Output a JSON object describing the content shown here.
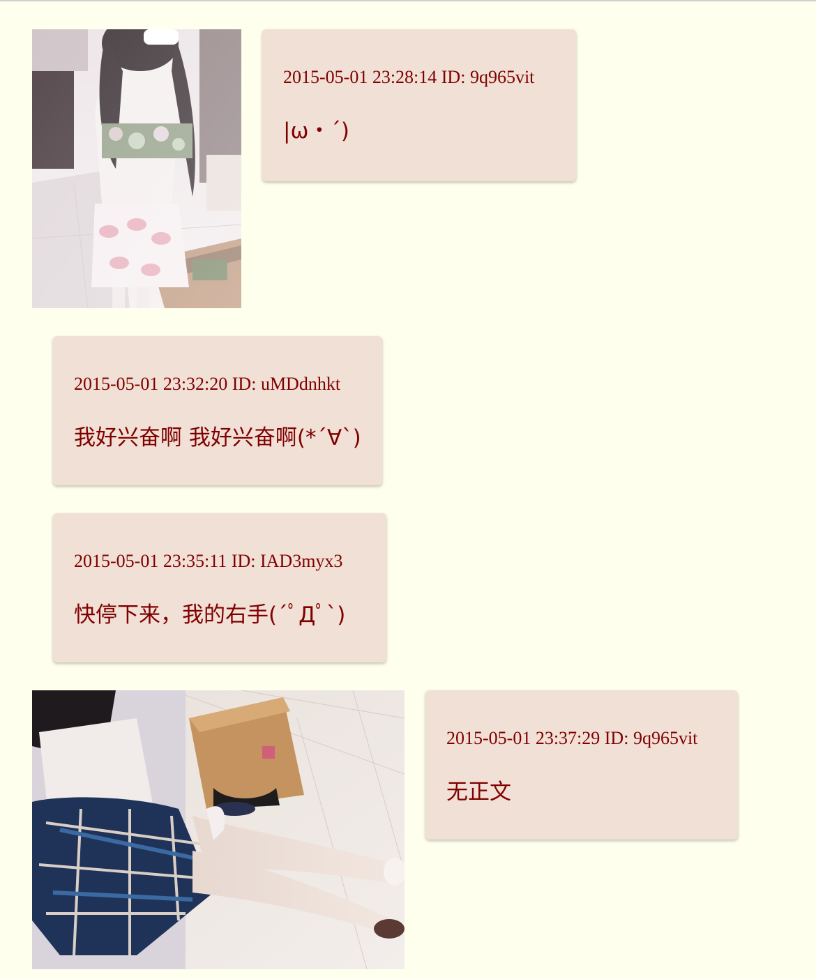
{
  "thread": {
    "posts": [
      {
        "datetime": "2015-05-01 23:28:14",
        "id_label": "ID:",
        "id": "9q965vit",
        "text": "|ω・´)",
        "has_image": true
      },
      {
        "datetime": "2015-05-01 23:32:20",
        "id_label": "ID:",
        "id": "uMDdnhkt",
        "text": "我好兴奋啊 我好兴奋啊(*´∀`)",
        "has_image": false
      },
      {
        "datetime": "2015-05-01 23:35:11",
        "id_label": "ID:",
        "id": "IAD3myx3",
        "text": "快停下来，我的右手(´ﾟДﾟ`)",
        "has_image": false
      },
      {
        "datetime": "2015-05-01 23:37:29",
        "id_label": "ID:",
        "id": "9q965vit",
        "text": "无正文",
        "has_image": true
      }
    ]
  },
  "colors": {
    "page_background": "#ffffee",
    "reply_background": "#f0e0d6",
    "text": "#800000"
  }
}
